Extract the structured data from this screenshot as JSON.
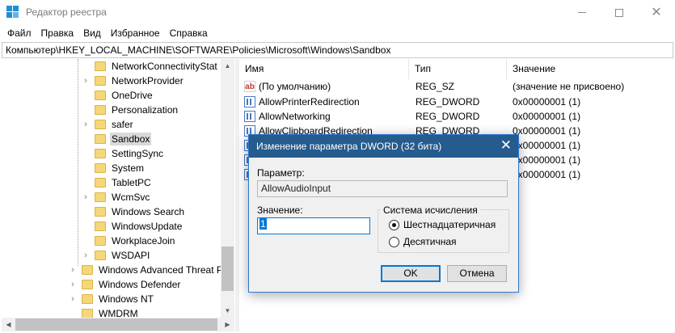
{
  "window": {
    "title": "Редактор реестра"
  },
  "menu": [
    "Файл",
    "Правка",
    "Вид",
    "Избранное",
    "Справка"
  ],
  "address": "Компьютер\\HKEY_LOCAL_MACHINE\\SOFTWARE\\Policies\\Microsoft\\Windows\\Sandbox",
  "tree": {
    "items": [
      {
        "label": "NetworkConnectivityStat",
        "expand": ""
      },
      {
        "label": "NetworkProvider",
        "expand": "›"
      },
      {
        "label": "OneDrive",
        "expand": ""
      },
      {
        "label": "Personalization",
        "expand": ""
      },
      {
        "label": "safer",
        "expand": "›"
      },
      {
        "label": "Sandbox",
        "expand": ""
      },
      {
        "label": "SettingSync",
        "expand": ""
      },
      {
        "label": "System",
        "expand": ""
      },
      {
        "label": "TabletPC",
        "expand": ""
      },
      {
        "label": "WcmSvc",
        "expand": "›"
      },
      {
        "label": "Windows Search",
        "expand": ""
      },
      {
        "label": "WindowsUpdate",
        "expand": ""
      },
      {
        "label": "WorkplaceJoin",
        "expand": ""
      },
      {
        "label": "WSDAPI",
        "expand": "›"
      },
      {
        "label": "Windows Advanced Threat P",
        "expand": "›"
      },
      {
        "label": "Windows Defender",
        "expand": "›"
      },
      {
        "label": "Windows NT",
        "expand": "›"
      },
      {
        "label": "WMDRM",
        "expand": ""
      }
    ]
  },
  "list": {
    "columns": [
      "Имя",
      "Тип",
      "Значение"
    ],
    "rows": [
      {
        "name": "(По умолчанию)",
        "type": "REG_SZ",
        "value": "(значение не присвоено)",
        "icon": "string-value-icon"
      },
      {
        "name": "AllowPrinterRedirection",
        "type": "REG_DWORD",
        "value": "0x00000001 (1)",
        "icon": "dword-value-icon"
      },
      {
        "name": "AllowNetworking",
        "type": "REG_DWORD",
        "value": "0x00000001 (1)",
        "icon": "dword-value-icon"
      },
      {
        "name": "AllowClipboardRedirection",
        "type": "REG_DWORD",
        "value": "0x00000001 (1)",
        "icon": "dword-value-icon"
      },
      {
        "name": "",
        "type": "",
        "value": "0x00000001 (1)",
        "icon": "dword-value-icon"
      },
      {
        "name": "",
        "type": "",
        "value": "0x00000001 (1)",
        "icon": "dword-value-icon"
      },
      {
        "name": "",
        "type": "",
        "value": "0x00000001 (1)",
        "icon": "dword-value-icon"
      }
    ]
  },
  "dialog": {
    "title": "Изменение параметра DWORD (32 бита)",
    "param_label": "Параметр:",
    "param_value": "AllowAudioInput",
    "value_label": "Значение:",
    "value_input": "1",
    "base_group": "Система исчисления",
    "radio_hex": "Шестнадцатеричная",
    "radio_dec": "Десятичная",
    "selected_base": "hex",
    "ok": "OK",
    "cancel": "Отмена"
  }
}
